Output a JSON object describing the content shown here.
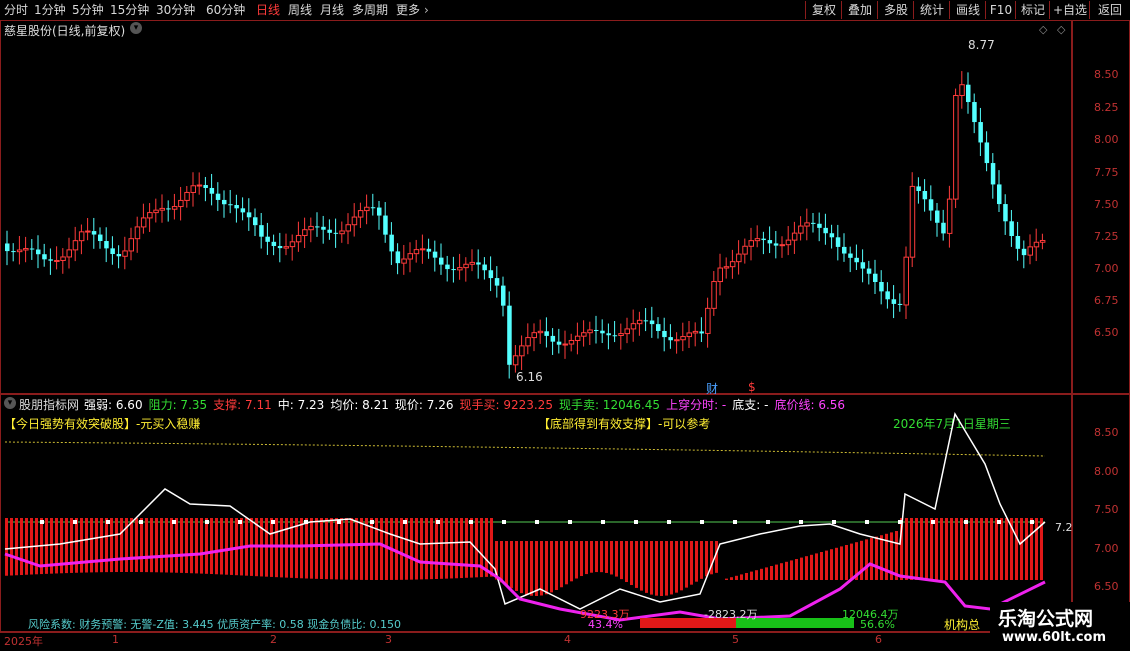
{
  "toolbar": {
    "periods": [
      "分时",
      "1分钟",
      "5分钟",
      "15分钟",
      "30分钟",
      "60分钟",
      "日线",
      "周线",
      "月线",
      "多周期",
      "更多"
    ],
    "active_period": "日线",
    "right_buttons": [
      "复权",
      "叠加",
      "多股",
      "统计",
      "画线",
      "F10",
      "标记",
      "+自选",
      "返回"
    ]
  },
  "main": {
    "title": "慈星股份(日线,前复权)",
    "high_label": "8.77",
    "low_label": "6.16",
    "marker_cai": "财",
    "marker_s": "$",
    "price_axis": [
      "8.50",
      "8.25",
      "8.00",
      "7.75",
      "7.50",
      "7.25",
      "7.00",
      "6.75",
      "6.50"
    ]
  },
  "indicator": {
    "name": "股朋指标网",
    "fields": [
      {
        "label": "强弱:",
        "value": "6.60",
        "color": "#ffffff"
      },
      {
        "label": "阻力:",
        "value": "7.35",
        "color": "#33dd33"
      },
      {
        "label": "支撑:",
        "value": "7.11",
        "color": "#ff3b3b"
      },
      {
        "label": "中:",
        "value": "7.23",
        "color": "#ffffff"
      },
      {
        "label": "均价:",
        "value": "8.21",
        "color": "#ffffff"
      },
      {
        "label": "现价:",
        "value": "7.26",
        "color": "#ffffff"
      },
      {
        "label": "现手买:",
        "value": "9223.25",
        "color": "#ff3b3b"
      },
      {
        "label": "现手卖:",
        "value": "12046.45",
        "color": "#33dd33"
      },
      {
        "label": "上穿分时:",
        "value": "-",
        "color": "#ff44ff"
      },
      {
        "label": "底支:",
        "value": "-",
        "color": "#ffffff"
      },
      {
        "label": "底价线:",
        "value": "6.56",
        "color": "#ff44ff"
      }
    ],
    "notice_left": "【今日强势有效突破股】-元买入稳赚",
    "notice_mid": "【底部得到有效支撑】-可以参考",
    "date_label": "2026年7月1日星期三",
    "right_value": "7.2",
    "axis": [
      "8.50",
      "8.00",
      "7.50",
      "7.00",
      "6.50"
    ],
    "buy_value": "9223.3万",
    "diff_value": "-2823.2万",
    "sell_value": "12046.4万",
    "pct_left": "43.4%",
    "pct_right": "56.6%",
    "footer": "风险系数: 财务预警: 无警-Z值: 3.445 优质资产率: 0.58 现金负债比: 0.150",
    "footer_right": "机构总"
  },
  "dates": {
    "year": "2025年",
    "months": [
      "1",
      "2",
      "3",
      "4",
      "5",
      "6"
    ]
  },
  "watermark": {
    "title": "乐淘公式网",
    "url": "www.60lt.com"
  }
}
